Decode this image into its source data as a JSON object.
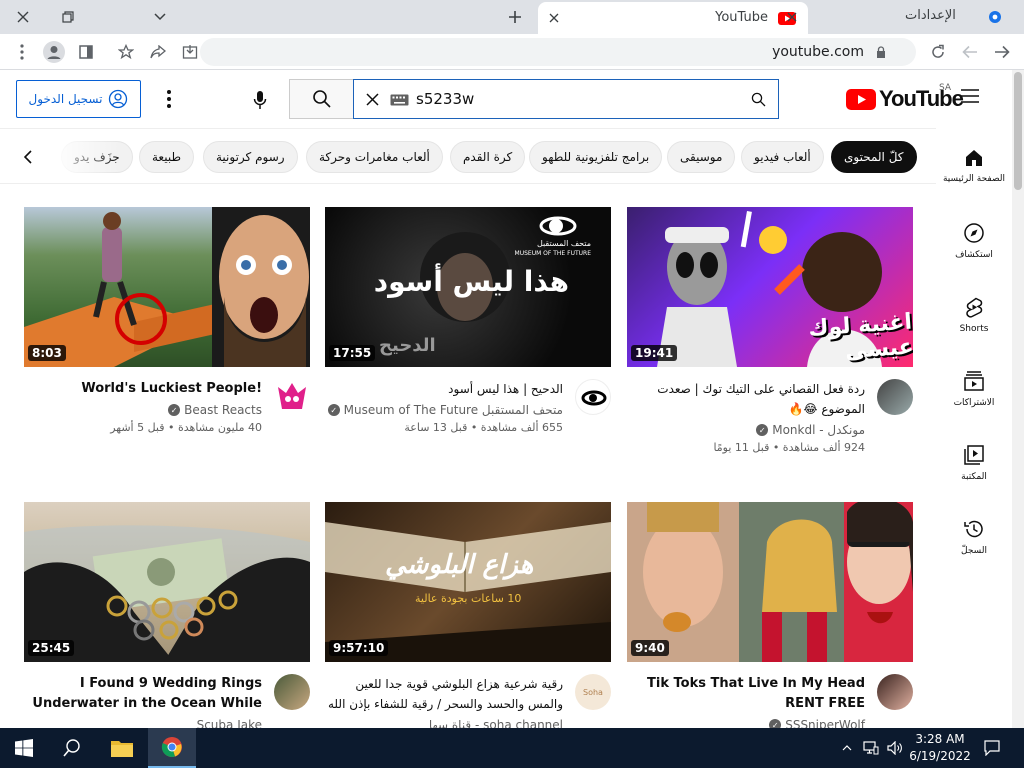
{
  "browser": {
    "tab_title": "YouTube",
    "settings_tab": "الإعدادات",
    "url": "youtube.com"
  },
  "header": {
    "signin_label": "تسجيل الدخول",
    "search_query": "s5233w",
    "logo_text": "YouTube",
    "country_code": "SA"
  },
  "chips": [
    {
      "label": "كلّ المحتوى",
      "active": true
    },
    {
      "label": "ألعاب فيديو"
    },
    {
      "label": "موسيقى"
    },
    {
      "label": "برامج تلفزيونية للطهو"
    },
    {
      "label": "كرة القدم"
    },
    {
      "label": "ألعاب مغامرات وحركة"
    },
    {
      "label": "رسوم كرتونية"
    },
    {
      "label": "طبيعة"
    },
    {
      "label": "جزَف يدو"
    }
  ],
  "guide": [
    {
      "label": "الصفحة الرئيسية",
      "icon": "home-icon"
    },
    {
      "label": "استكشاف",
      "icon": "explore-icon"
    },
    {
      "label": "Shorts",
      "icon": "shorts-icon"
    },
    {
      "label": "الاشتراكات",
      "icon": "subscriptions-icon"
    },
    {
      "label": "المكتبة",
      "icon": "library-icon"
    },
    {
      "label": "السجلّ",
      "icon": "history-icon"
    }
  ],
  "videos": [
    {
      "title": "ردة فعل القصاني على التيك توك | صعدت الموضوع 😂🔥",
      "channel": "مونكدل - Monkdl",
      "stats": "924 ألف مشاهدة • قبل 11 يومًا",
      "duration": "19:41",
      "thumb_text": "اغنية لوك عيسى"
    },
    {
      "title": "الدحيح | هذا ليس أسود",
      "channel": "متحف المستقبل Museum of The Future",
      "stats": "655 ألف مشاهدة • قبل 13 ساعة",
      "duration": "17:55",
      "thumb_text": "هذا ليس أسود",
      "thumb_sub": "متحف المستقبل",
      "thumb_sub2": "MUSEUM OF THE FUTURE",
      "thumb_corner": "الدحيح"
    },
    {
      "title": "World's Luckiest People!",
      "channel": "Beast Reacts",
      "stats": "40 مليون مشاهدة • قبل 5 أشهر",
      "duration": "8:03"
    },
    {
      "title": "Tik Toks That Live In My Head RENT FREE",
      "channel": "SSSniperWolf",
      "stats": "",
      "duration": "9:40"
    },
    {
      "title": "رقية شرعية هزاع البلوشي قوية جدا للعين والمس والحسد والسحر / رقية للشفاء بإذن الله ...",
      "channel": "soha channel - قناة سها",
      "stats": "",
      "duration": "9:57:10",
      "thumb_text": "هزاع البلوشي",
      "thumb_sub": "10 ساعات بجودة عالية",
      "avatar_text": "Soha"
    },
    {
      "title": "I Found 9 Wedding Rings Underwater in the Ocean While",
      "channel": "Scuba Jake",
      "stats": "",
      "duration": "25:45"
    }
  ],
  "taskbar": {
    "time": "3:28 AM",
    "date": "6/19/2022"
  }
}
